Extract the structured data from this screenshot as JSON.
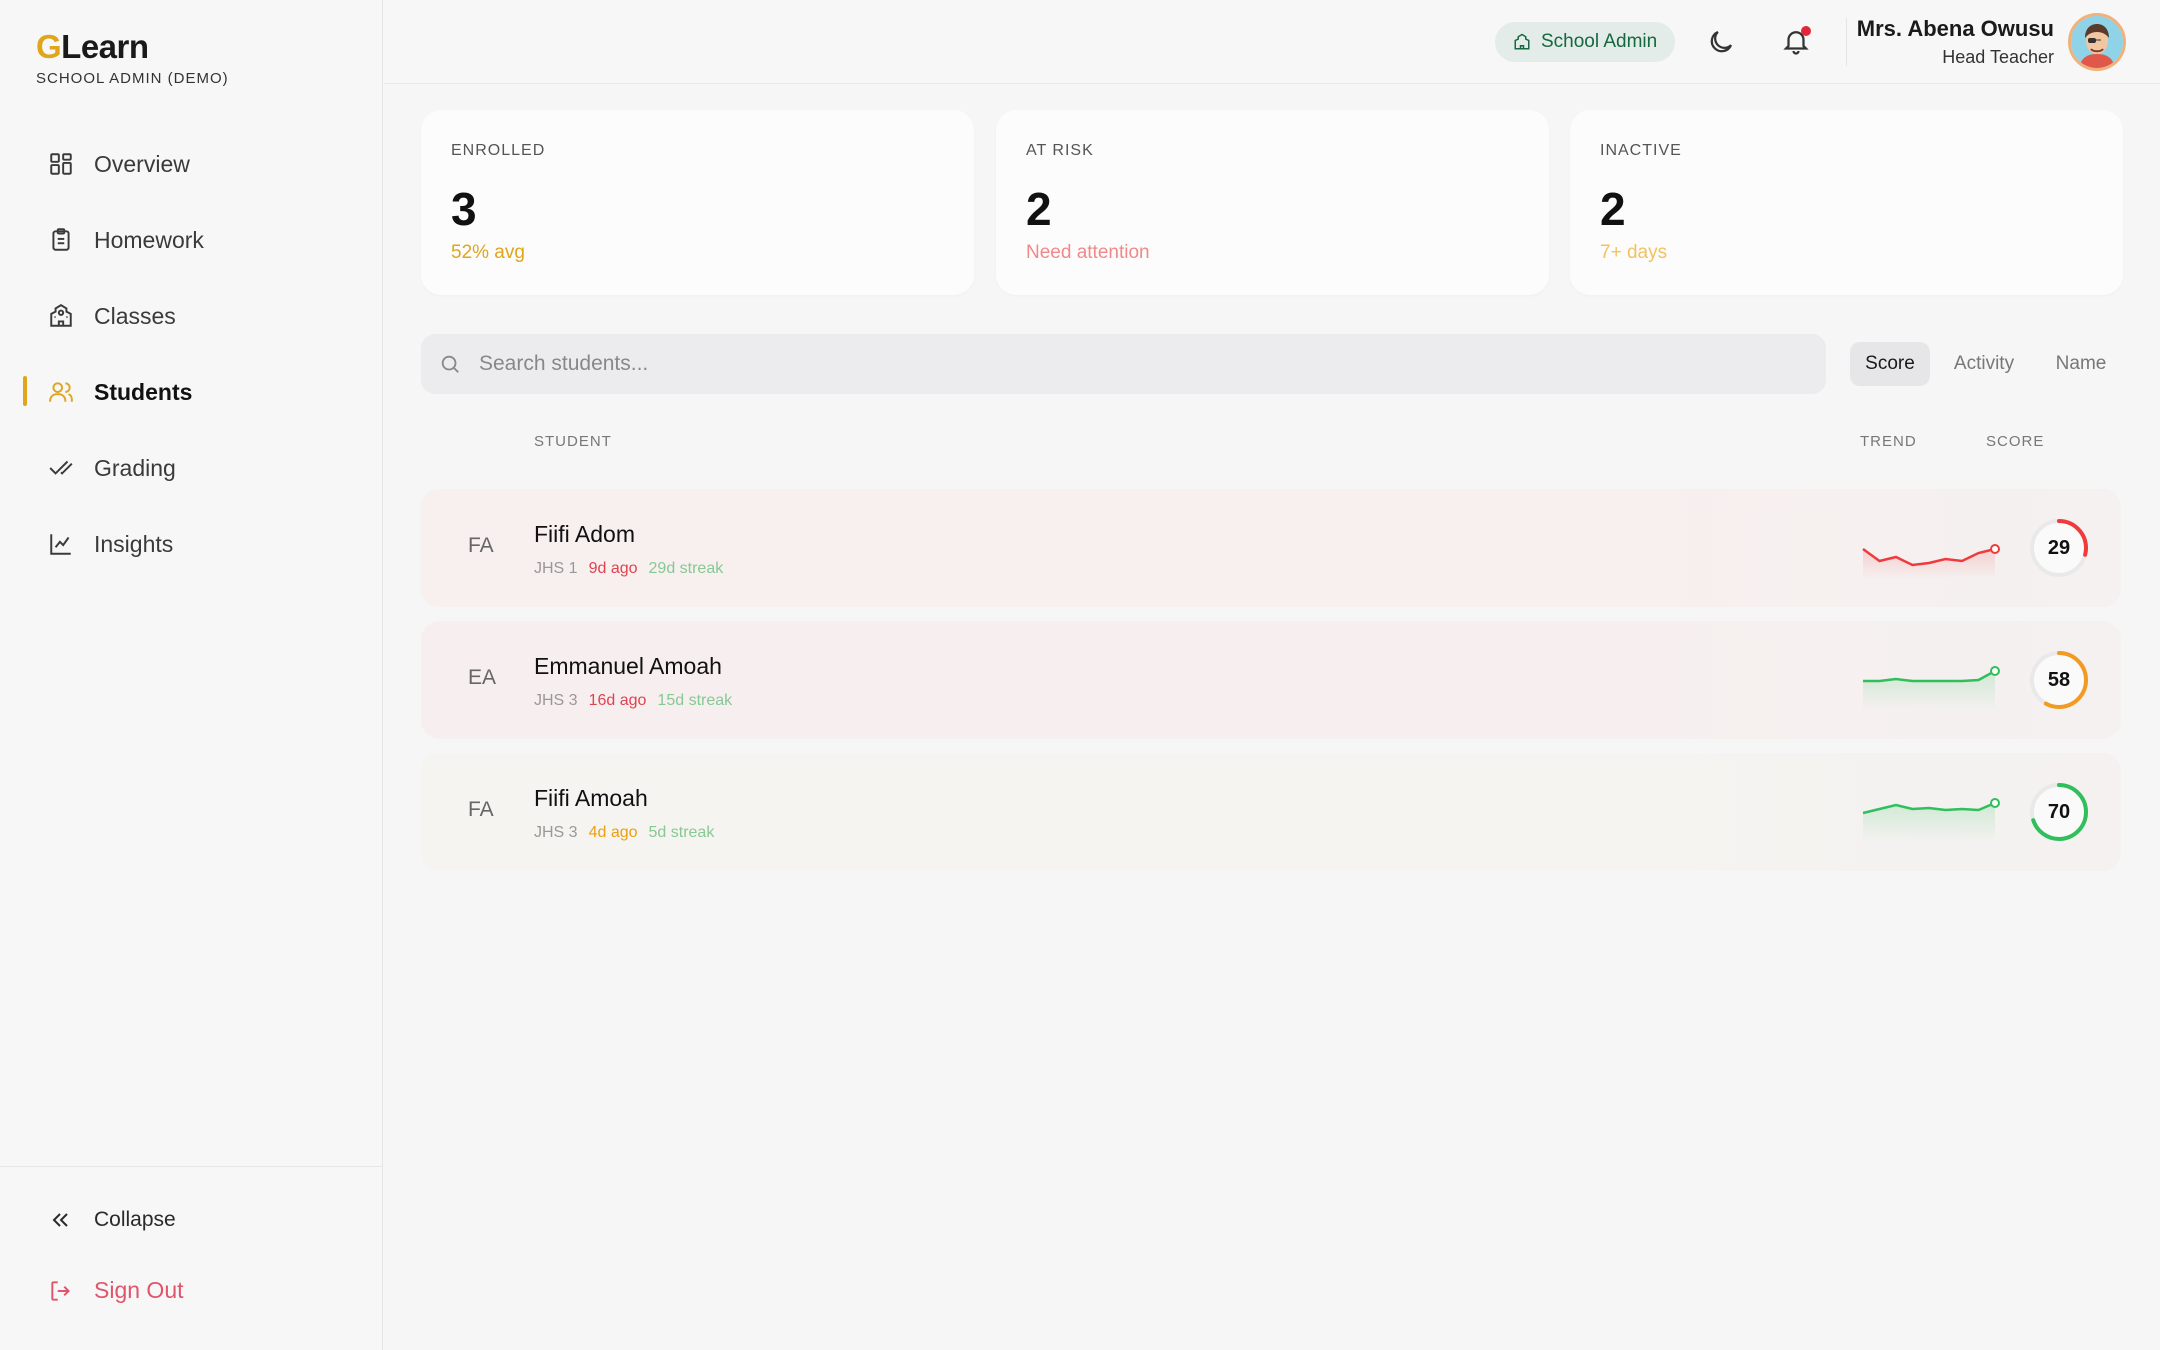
{
  "brand": {
    "first_letter": "G",
    "rest": "Learn",
    "subtitle": "SCHOOL ADMIN (DEMO)"
  },
  "nav": {
    "items": [
      {
        "label": "Overview",
        "icon": "grid-icon"
      },
      {
        "label": "Homework",
        "icon": "clipboard-icon"
      },
      {
        "label": "Classes",
        "icon": "school-building-icon"
      },
      {
        "label": "Students",
        "icon": "users-icon",
        "active": true
      },
      {
        "label": "Grading",
        "icon": "double-check-icon"
      },
      {
        "label": "Insights",
        "icon": "line-chart-icon"
      }
    ],
    "collapse_label": "Collapse",
    "signout_label": "Sign Out"
  },
  "topbar": {
    "role_pill": "School Admin",
    "user_name": "Mrs. Abena Owusu",
    "user_role": "Head Teacher"
  },
  "stats": [
    {
      "label": "ENROLLED",
      "value": "3",
      "sub": "52% avg",
      "sub_color": "#e0a51b"
    },
    {
      "label": "AT RISK",
      "value": "2",
      "sub": "Need attention",
      "sub_color": "#f08a8a"
    },
    {
      "label": "INACTIVE",
      "value": "2",
      "sub": "7+ days",
      "sub_color": "#f3c25a"
    }
  ],
  "search": {
    "placeholder": "Search students..."
  },
  "sort": {
    "options": [
      "Score",
      "Activity",
      "Name"
    ],
    "selected": "Score"
  },
  "table": {
    "headers": {
      "student": "STUDENT",
      "trend": "TREND",
      "score": "SCORE"
    },
    "rows": [
      {
        "initials": "FA",
        "name": "Fiifi Adom",
        "grade": "JHS 1",
        "last_active": "9d ago",
        "last_active_color": "#e0424f",
        "streak": "29d streak",
        "score": 29,
        "score_color": "#ef3b3b",
        "trend_color": "#ef3b3b",
        "bg": "#f8efef",
        "trend": [
          0.38,
          0.32,
          0.34,
          0.3,
          0.31,
          0.33,
          0.32,
          0.36,
          0.38
        ]
      },
      {
        "initials": "EA",
        "name": "Emmanuel Amoah",
        "grade": "JHS 3",
        "last_active": "16d ago",
        "last_active_color": "#e0424f",
        "streak": "15d streak",
        "score": 58,
        "score_color": "#f29a22",
        "trend_color": "#2fbf5b",
        "bg": "#f7efef",
        "trend": [
          0.57,
          0.57,
          0.58,
          0.57,
          0.57,
          0.57,
          0.57,
          0.575,
          0.62
        ]
      },
      {
        "initials": "FA",
        "name": "Fiifi Amoah",
        "grade": "JHS 3",
        "last_active": "4d ago",
        "last_active_color": "#eaa012",
        "streak": "5d streak",
        "score": 70,
        "score_color": "#2fbf5b",
        "trend_color": "#2fbf5b",
        "bg": "#f5f4f1",
        "trend": [
          0.67,
          0.69,
          0.71,
          0.69,
          0.695,
          0.685,
          0.69,
          0.685,
          0.72
        ]
      }
    ]
  },
  "colors": {
    "accent": "#e0a51b",
    "danger": "#e05569",
    "streak": "#86c993"
  }
}
